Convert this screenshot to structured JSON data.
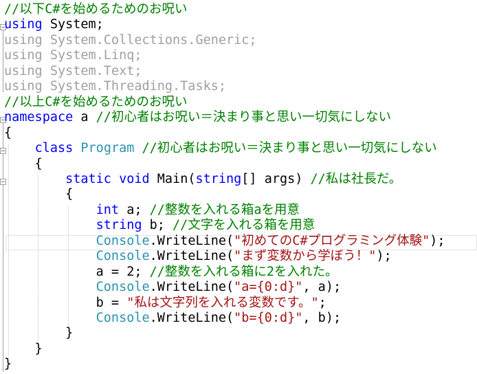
{
  "editor": {
    "colors": {
      "comment": "#008000",
      "keyword": "#0000ff",
      "type": "#2b91af",
      "string": "#a31515",
      "plain": "#000000",
      "unused": "#a0a0a0"
    },
    "lines": [
      {
        "tokens": [
          {
            "text": "//以下C#を始めるためのお呪い",
            "kind": "comment"
          }
        ]
      },
      {
        "tokens": [
          {
            "text": "using",
            "kind": "keyword"
          },
          {
            "text": " System;",
            "kind": "plain"
          }
        ]
      },
      {
        "tokens": [
          {
            "text": "using System.Collections.Generic;",
            "kind": "unused"
          }
        ]
      },
      {
        "tokens": [
          {
            "text": "using System.Linq;",
            "kind": "unused"
          }
        ]
      },
      {
        "tokens": [
          {
            "text": "using System.Text;",
            "kind": "unused"
          }
        ]
      },
      {
        "tokens": [
          {
            "text": "using System.Threading.Tasks;",
            "kind": "unused"
          }
        ]
      },
      {
        "tokens": [
          {
            "text": "//以上C#を始めるためのお呪い",
            "kind": "comment"
          }
        ]
      },
      {
        "tokens": [
          {
            "text": "namespace",
            "kind": "keyword"
          },
          {
            "text": " a ",
            "kind": "plain"
          },
          {
            "text": "//初心者はお呪い＝決まり事と思い一切気にしない",
            "kind": "comment"
          }
        ]
      },
      {
        "tokens": [
          {
            "text": "{",
            "kind": "plain"
          }
        ]
      },
      {
        "tokens": [
          {
            "text": "    ",
            "kind": "plain"
          },
          {
            "text": "class",
            "kind": "keyword"
          },
          {
            "text": " ",
            "kind": "plain"
          },
          {
            "text": "Program",
            "kind": "type"
          },
          {
            "text": " ",
            "kind": "plain"
          },
          {
            "text": "//初心者はお呪い＝決まり事と思い一切気にしない",
            "kind": "comment"
          }
        ]
      },
      {
        "tokens": [
          {
            "text": "    {",
            "kind": "plain"
          }
        ]
      },
      {
        "tokens": [
          {
            "text": "        ",
            "kind": "plain"
          },
          {
            "text": "static",
            "kind": "keyword"
          },
          {
            "text": " ",
            "kind": "plain"
          },
          {
            "text": "void",
            "kind": "keyword"
          },
          {
            "text": " Main(",
            "kind": "plain"
          },
          {
            "text": "string",
            "kind": "keyword"
          },
          {
            "text": "[] args) ",
            "kind": "plain"
          },
          {
            "text": "//私は社長だ。",
            "kind": "comment"
          }
        ]
      },
      {
        "tokens": [
          {
            "text": "        {",
            "kind": "plain"
          }
        ]
      },
      {
        "tokens": [
          {
            "text": "            ",
            "kind": "plain"
          },
          {
            "text": "int",
            "kind": "keyword"
          },
          {
            "text": " a; ",
            "kind": "plain"
          },
          {
            "text": "//整数を入れる箱aを用意",
            "kind": "comment"
          }
        ]
      },
      {
        "tokens": [
          {
            "text": "            ",
            "kind": "plain"
          },
          {
            "text": "string",
            "kind": "keyword"
          },
          {
            "text": " b; ",
            "kind": "plain"
          },
          {
            "text": "//文字を入れる箱を用意",
            "kind": "comment"
          }
        ]
      },
      {
        "tokens": [
          {
            "text": "            ",
            "kind": "plain"
          },
          {
            "text": "Console",
            "kind": "type"
          },
          {
            "text": ".WriteLine(",
            "kind": "plain"
          },
          {
            "text": "\"初めてのC#プログラミング体験\"",
            "kind": "string"
          },
          {
            "text": ");",
            "kind": "plain"
          }
        ]
      },
      {
        "tokens": [
          {
            "text": "            ",
            "kind": "plain"
          },
          {
            "text": "Console",
            "kind": "type"
          },
          {
            "text": ".WriteLine(",
            "kind": "plain"
          },
          {
            "text": "\"まず変数から学ぼう！\"",
            "kind": "string"
          },
          {
            "text": ");",
            "kind": "plain"
          }
        ]
      },
      {
        "tokens": [
          {
            "text": "            a = 2; ",
            "kind": "plain"
          },
          {
            "text": "//整数を入れる箱に2を入れた。",
            "kind": "comment"
          }
        ]
      },
      {
        "tokens": [
          {
            "text": "            ",
            "kind": "plain"
          },
          {
            "text": "Console",
            "kind": "type"
          },
          {
            "text": ".WriteLine(",
            "kind": "plain"
          },
          {
            "text": "\"a={0:d}\"",
            "kind": "string"
          },
          {
            "text": ", a);",
            "kind": "plain"
          }
        ]
      },
      {
        "tokens": [
          {
            "text": "            b = ",
            "kind": "plain"
          },
          {
            "text": "\"私は文字列を入れる変数です。\"",
            "kind": "string"
          },
          {
            "text": ";",
            "kind": "plain"
          }
        ]
      },
      {
        "tokens": [
          {
            "text": "            ",
            "kind": "plain"
          },
          {
            "text": "Console",
            "kind": "type"
          },
          {
            "text": ".WriteLine(",
            "kind": "plain"
          },
          {
            "text": "\"b={0:d}\"",
            "kind": "string"
          },
          {
            "text": ", b);",
            "kind": "plain"
          }
        ]
      },
      {
        "tokens": [
          {
            "text": "        }",
            "kind": "plain"
          }
        ]
      },
      {
        "tokens": [
          {
            "text": "    }",
            "kind": "plain"
          }
        ]
      },
      {
        "tokens": [
          {
            "text": "}",
            "kind": "plain"
          }
        ]
      }
    ]
  }
}
